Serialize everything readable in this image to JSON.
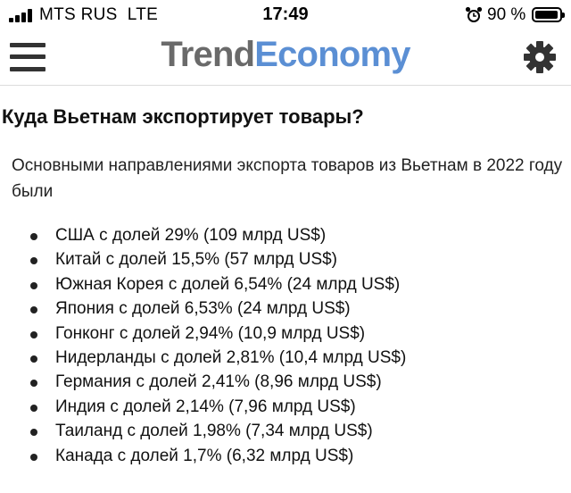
{
  "status_bar": {
    "carrier": "MTS RUS",
    "network": "LTE",
    "time": "17:49",
    "battery_percent": "90 %",
    "signal_bars": 4,
    "icons": [
      "signal-icon",
      "alarm-icon",
      "battery-icon"
    ]
  },
  "header": {
    "logo_part1": "Trend",
    "logo_part2": "Economy",
    "logo_colors": {
      "part1": "#6a6a6a",
      "part2": "#5b8fd4"
    },
    "icons": [
      "menu-icon",
      "gear-icon"
    ]
  },
  "page": {
    "title": "Куда Вьетнам экспортирует товары?",
    "intro": "Основными направлениями экспорта товаров из Вьетнам в 2022 году были",
    "items": [
      "США с долей 29% (109 млрд US$)",
      "Китай с долей 15,5% (57 млрд US$)",
      "Южная Корея с долей 6,54% (24 млрд US$)",
      "Япония с долей 6,53% (24 млрд US$)",
      "Гонконг с долей 2,94% (10,9 млрд US$)",
      "Нидерланды с долей 2,81% (10,4 млрд US$)",
      "Германия с долей 2,41% (8,96 млрд US$)",
      "Индия с долей 2,14% (7,96 млрд US$)",
      "Таиланд с долей 1,98% (7,34 млрд US$)",
      "Канада с долей 1,7% (6,32 млрд US$)"
    ]
  }
}
